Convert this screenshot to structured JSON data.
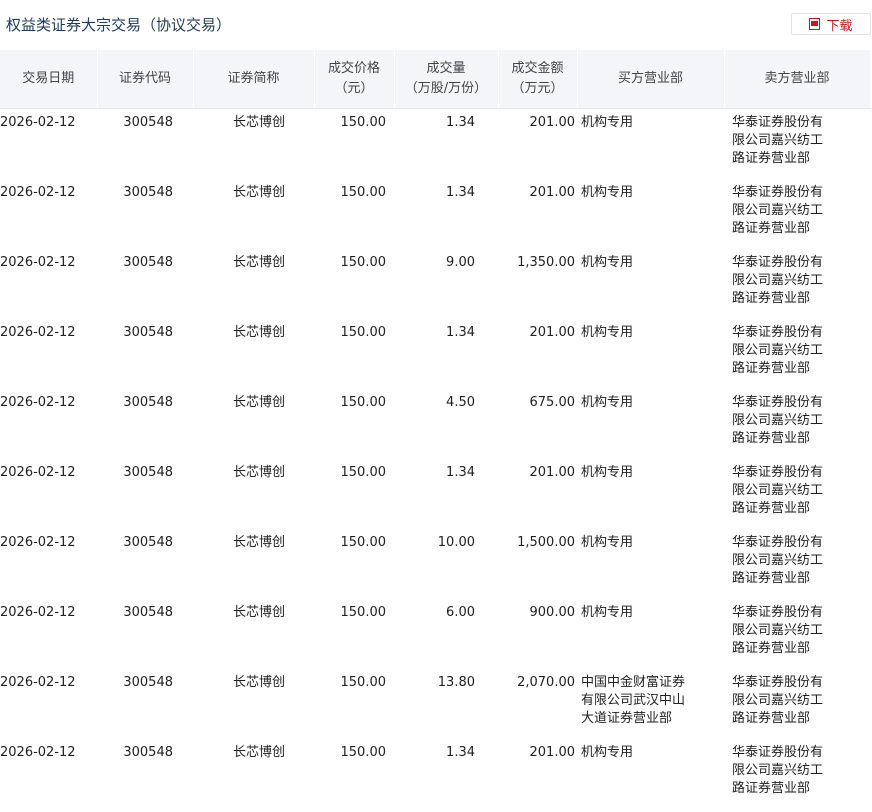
{
  "header": {
    "title": "权益类证券大宗交易（协议交易）",
    "download_label": "下载",
    "download_icon": "pdf-file-icon"
  },
  "table": {
    "columns": [
      {
        "line1": "交易日期",
        "line2": ""
      },
      {
        "line1": "证券代码",
        "line2": ""
      },
      {
        "line1": "证券简称",
        "line2": ""
      },
      {
        "line1": "成交价格",
        "line2": "（元）"
      },
      {
        "line1": "成交量",
        "line2": "（万股/万份）"
      },
      {
        "line1": "成交金额",
        "line2": "（万元）"
      },
      {
        "line1": "买方营业部",
        "line2": ""
      },
      {
        "line1": "卖方营业部",
        "line2": ""
      }
    ],
    "rows": [
      {
        "date": "2026-02-12",
        "code": "300548",
        "name": "长芯博创",
        "price": "150.00",
        "volume": "1.34",
        "amount": "201.00",
        "buyer": "机构专用",
        "seller": "华泰证券股份有限公司嘉兴纺工路证券营业部"
      },
      {
        "date": "2026-02-12",
        "code": "300548",
        "name": "长芯博创",
        "price": "150.00",
        "volume": "1.34",
        "amount": "201.00",
        "buyer": "机构专用",
        "seller": "华泰证券股份有限公司嘉兴纺工路证券营业部"
      },
      {
        "date": "2026-02-12",
        "code": "300548",
        "name": "长芯博创",
        "price": "150.00",
        "volume": "9.00",
        "amount": "1,350.00",
        "buyer": "机构专用",
        "seller": "华泰证券股份有限公司嘉兴纺工路证券营业部"
      },
      {
        "date": "2026-02-12",
        "code": "300548",
        "name": "长芯博创",
        "price": "150.00",
        "volume": "1.34",
        "amount": "201.00",
        "buyer": "机构专用",
        "seller": "华泰证券股份有限公司嘉兴纺工路证券营业部"
      },
      {
        "date": "2026-02-12",
        "code": "300548",
        "name": "长芯博创",
        "price": "150.00",
        "volume": "4.50",
        "amount": "675.00",
        "buyer": "机构专用",
        "seller": "华泰证券股份有限公司嘉兴纺工路证券营业部"
      },
      {
        "date": "2026-02-12",
        "code": "300548",
        "name": "长芯博创",
        "price": "150.00",
        "volume": "1.34",
        "amount": "201.00",
        "buyer": "机构专用",
        "seller": "华泰证券股份有限公司嘉兴纺工路证券营业部"
      },
      {
        "date": "2026-02-12",
        "code": "300548",
        "name": "长芯博创",
        "price": "150.00",
        "volume": "10.00",
        "amount": "1,500.00",
        "buyer": "机构专用",
        "seller": "华泰证券股份有限公司嘉兴纺工路证券营业部"
      },
      {
        "date": "2026-02-12",
        "code": "300548",
        "name": "长芯博创",
        "price": "150.00",
        "volume": "6.00",
        "amount": "900.00",
        "buyer": "机构专用",
        "seller": "华泰证券股份有限公司嘉兴纺工路证券营业部"
      },
      {
        "date": "2026-02-12",
        "code": "300548",
        "name": "长芯博创",
        "price": "150.00",
        "volume": "13.80",
        "amount": "2,070.00",
        "buyer": "中国中金财富证券有限公司武汉中山大道证券营业部",
        "seller": "华泰证券股份有限公司嘉兴纺工路证券营业部"
      },
      {
        "date": "2026-02-12",
        "code": "300548",
        "name": "长芯博创",
        "price": "150.00",
        "volume": "1.34",
        "amount": "201.00",
        "buyer": "机构专用",
        "seller": "华泰证券股份有限公司嘉兴纺工路证券营业部"
      }
    ]
  },
  "colors": {
    "title": "#1f3a5c",
    "download": "#c8161e",
    "header_bg": "#f3f5f8"
  }
}
